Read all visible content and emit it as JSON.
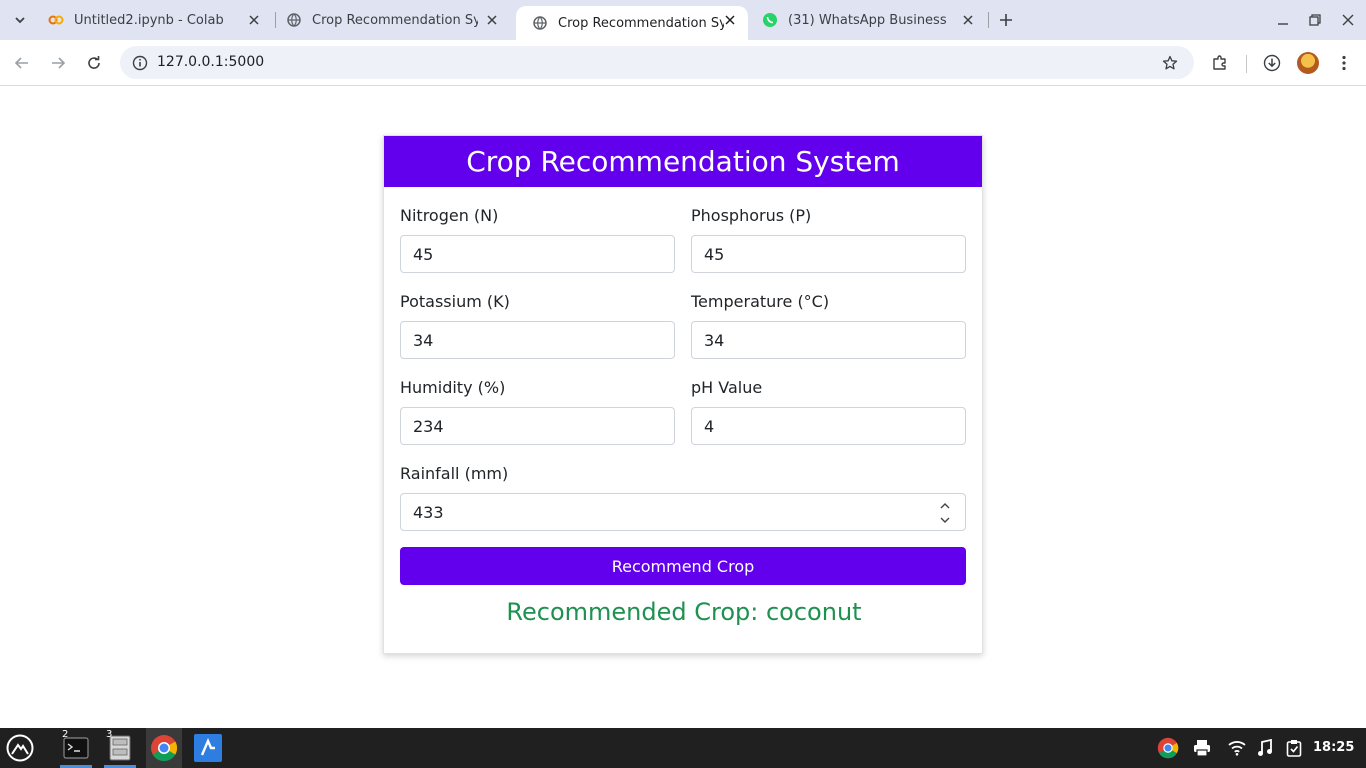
{
  "browser": {
    "tabs": [
      {
        "title": "Untitled2.ipynb - Colab",
        "icon": "colab-icon",
        "active": false
      },
      {
        "title": "Crop Recommendation System",
        "icon": "globe-icon",
        "active": false
      },
      {
        "title": "Crop Recommendation System",
        "icon": "globe-icon",
        "active": true
      },
      {
        "title": "(31) WhatsApp Business",
        "icon": "whatsapp-icon",
        "active": false
      }
    ],
    "url": "127.0.0.1:5000"
  },
  "page": {
    "title": "Crop Recommendation System",
    "fields": [
      {
        "label": "Nitrogen (N)",
        "value": "45"
      },
      {
        "label": "Phosphorus (P)",
        "value": "45"
      },
      {
        "label": "Potassium (K)",
        "value": "34"
      },
      {
        "label": "Temperature (°C)",
        "value": "34"
      },
      {
        "label": "Humidity (%)",
        "value": "234"
      },
      {
        "label": "pH Value",
        "value": "4"
      },
      {
        "label": "Rainfall (mm)",
        "value": "433"
      }
    ],
    "submit_label": "Recommend Crop",
    "result": "Recommended Crop: coconut"
  },
  "taskbar": {
    "apps": [
      {
        "name": "terminal",
        "badge": "2"
      },
      {
        "name": "file-manager",
        "badge": "3"
      },
      {
        "name": "chrome",
        "badge": ""
      },
      {
        "name": "app",
        "badge": ""
      }
    ],
    "clock": "18:25"
  },
  "colors": {
    "accent": "#6200ee",
    "result": "#1e9150",
    "tabstrip": "#dfe3f2",
    "taskbar": "#202020"
  }
}
